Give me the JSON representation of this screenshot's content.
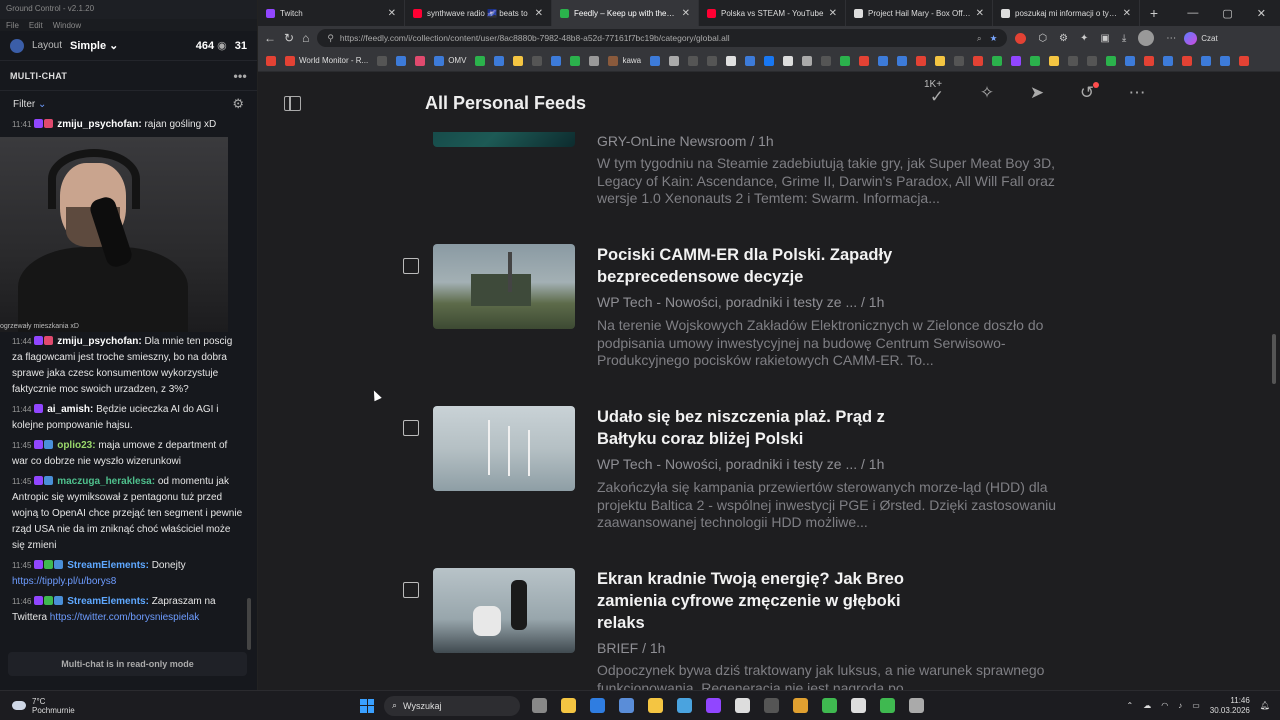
{
  "gc": {
    "title": "Ground Control - v2.1.20",
    "menu": [
      "File",
      "Edit",
      "Window"
    ],
    "layout_label": "Layout",
    "layout_mode": "Simple",
    "viewers": "464",
    "second_count": "31",
    "section": "MULTI-CHAT",
    "filter": "Filter",
    "webcam_caption": "ogrzewały mieszkania xD",
    "readonly": "Multi-chat is in read-only mode",
    "messages_top": [
      {
        "time": "11:41",
        "user": "zmiju_psychofan:",
        "user_color": "#ffffff",
        "text": " rajan gośling xD",
        "badges": [
          "#9146ff",
          "#e04a6e"
        ]
      }
    ],
    "messages": [
      {
        "time": "11:44",
        "user": "zmiju_psychofan:",
        "user_color": "#ffffff",
        "text": " Dla mnie ten poscig za flagowcami jest troche smieszny, bo na dobra sprawe jaka czesc konsumentow wykorzystuje faktycznie moc swoich urzadzen, z 3%?",
        "badges": [
          "#9146ff",
          "#e04a6e"
        ]
      },
      {
        "time": "11:44",
        "user": "ai_amish:",
        "user_color": "#ffffff",
        "text": " Będzie ucieczka AI do AGI i kolejne pompowanie hajsu.",
        "badges": [
          "#9146ff"
        ]
      },
      {
        "time": "11:45",
        "user": "oplio23:",
        "user_color": "#9ad86b",
        "text": " maja umowe z department of war co dobrze nie wyszło wizerunkowi",
        "badges": [
          "#9146ff",
          "#4a8fd8"
        ]
      },
      {
        "time": "11:45",
        "user": "maczuga_heraklesa:",
        "user_color": "#4fc08d",
        "text": " od momentu jak Antropic się wymiksował z pentagonu tuż przed wojną to OpenAI chce przejąć ten segment i pewnie rząd USA nie da im zniknąć choć właściciel może się zmieni",
        "badges": [
          "#9146ff",
          "#4a8fd8"
        ]
      },
      {
        "time": "11:45",
        "user": "StreamElements:",
        "user_color": "#5fa8ff",
        "text": " Donejty ",
        "link": "https://tipply.pl/u/borys8",
        "badges": [
          "#9146ff",
          "#3fb950",
          "#4a8fd8"
        ]
      },
      {
        "time": "11:46",
        "user": "StreamElements:",
        "user_color": "#5fa8ff",
        "text": " Zapraszam na Twittera ",
        "link": "https://twitter.com/borysniespielak",
        "badges": [
          "#9146ff",
          "#3fb950",
          "#4a8fd8"
        ]
      }
    ]
  },
  "browser": {
    "tabs": [
      {
        "label": "Twitch",
        "color": "#9146ff",
        "active": false
      },
      {
        "label": "synthwave radio 🌌 beats to",
        "color": "#ff0033",
        "active": false
      },
      {
        "label": "Feedly – Keep up with the topics",
        "color": "#2bb24c",
        "active": true
      },
      {
        "label": "Polska vs STEAM - YouTube",
        "color": "#ff0033",
        "active": false
      },
      {
        "label": "Project Hail Mary - Box Office Mo",
        "color": "#dddddd",
        "active": false
      },
      {
        "label": "poszukaj mi informacji o tym ze o",
        "color": "#dddddd",
        "active": false
      }
    ],
    "url": "https://feedly.com/i/collection/content/user/8ac8880b-7982-48b8-a52d-77161f7bc19b/category/global.all",
    "czat": "Czat",
    "bookmarks": [
      {
        "label": "World Monitor - R...",
        "color": "#e34234"
      },
      {
        "label": "OMV",
        "color": "#3d7bd9"
      },
      {
        "label": "kawa",
        "color": "#8a5a3c"
      }
    ],
    "bookmark_icons": [
      "#e34234",
      "#555",
      "#3d7bd9",
      "#e04a6e",
      "#2bb24c",
      "#3d7bd9",
      "#f4c542",
      "#555",
      "#3d7bd9",
      "#2bb24c",
      "#999",
      "#3d7bd9",
      "#aaa",
      "#555",
      "#555",
      "#e0e0e0",
      "#3d7bd9",
      "#1877f2",
      "#dddddd",
      "#aaa",
      "#555",
      "#2bb24c",
      "#e34234",
      "#3d7bd9",
      "#3d7bd9",
      "#e34234",
      "#f4c542",
      "#555",
      "#e34234",
      "#2bb24c",
      "#9146ff",
      "#2bb24c",
      "#f4c542",
      "#555",
      "#555",
      "#2bb24c",
      "#3d7bd9",
      "#e34234",
      "#3d7bd9",
      "#e34234",
      "#3d7bd9",
      "#3d7bd9",
      "#e34234"
    ]
  },
  "feedly": {
    "title": "All Personal Feeds",
    "unread_badge": "1K+",
    "articles": [
      {
        "title": "",
        "source": "GRY-OnLine Newsroom / 1h",
        "summary": "W tym tygodniu na Steamie zadebiutują takie gry, jak Super Meat Boy 3D, Legacy of Kain: Ascendance, Grime II, Darwin's Paradox, All Will Fall oraz wersje 1.0 Xenonauts 2 i Temtem: Swarm. Informacja..."
      },
      {
        "title": "Pociski CAMM-ER dla Polski. Zapadły bezprecedensowe decyzje",
        "source": "WP Tech - Nowości, poradniki i testy ze ... / 1h",
        "summary": "Na terenie Wojskowych Zakładów Elektronicznych w Zielonce doszło do podpisania umowy inwestycyjnej na budowę Centrum Serwisowo-Produkcyjnego pocisków rakietowych CAMM-ER. To..."
      },
      {
        "title": "Udało się bez niszczenia plaż. Prąd z Bałtyku coraz bliżej Polski",
        "source": "WP Tech - Nowości, poradniki i testy ze ... / 1h",
        "summary": "Zakończyła się kampania przewiertów sterowanych morze-ląd (HDD) dla projektu Baltica 2 - wspólnej inwestycji PGE i Ørsted. Dzięki zastosowaniu zaawansowanej technologii HDD możliwe..."
      },
      {
        "title": "Ekran kradnie Twoją energię? Jak Breo zamienia cyfrowe zmęczenie w głęboki relaks",
        "source": "BRIEF / 1h",
        "summary": "Odpoczynek bywa dziś traktowany jak luksus, a nie warunek sprawnego funkcjonowania. Regeneracja nie jest nagrodą po..."
      }
    ]
  },
  "taskbar": {
    "temp": "7°C",
    "weather": "Pochmurnie",
    "search": "Wyszukaj",
    "time": "11:46",
    "date": "30.03.2026",
    "icons": [
      "#888",
      "#f4c542",
      "#2f7de1",
      "#5a8dd8",
      "#f4c542",
      "#4aa3df",
      "#9146ff",
      "#dddddd",
      "#555",
      "#e0a030",
      "#3fb950",
      "#dddddd",
      "#3fb950",
      "#aaa"
    ]
  }
}
